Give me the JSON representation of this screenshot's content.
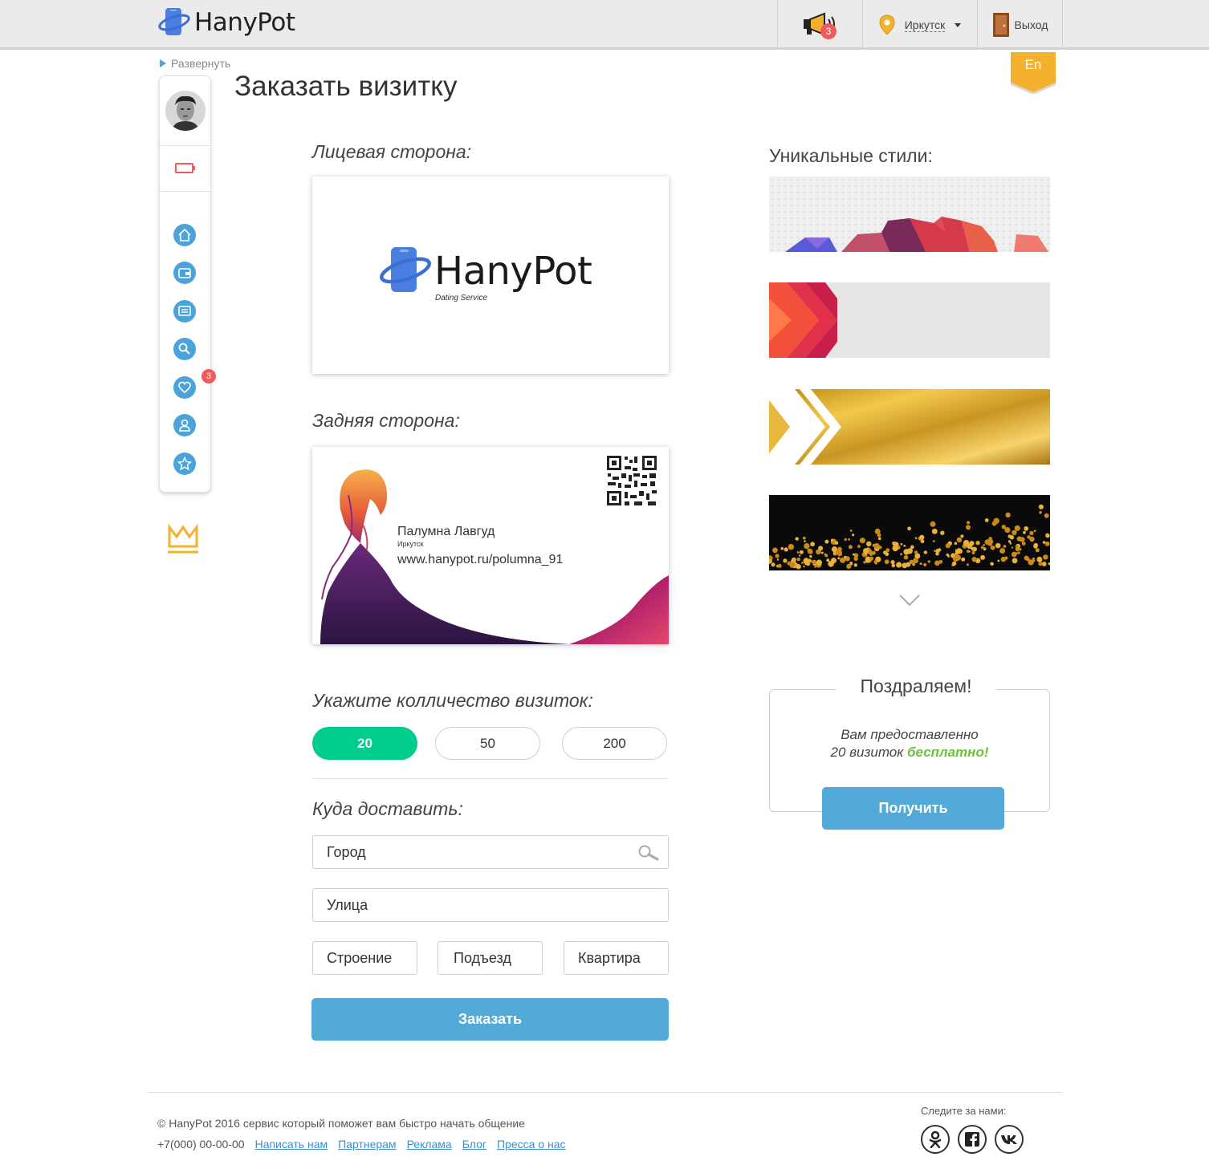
{
  "header": {
    "logo": "HanyPot",
    "notifications_count": "3",
    "city": "Иркутск",
    "exit_label": "Выход",
    "lang": "En"
  },
  "sidebar": {
    "expand_label": "Развернуть",
    "likes_badge": "3",
    "icons": [
      "home-icon",
      "wallet-icon",
      "messages-icon",
      "search-icon",
      "heart-icon",
      "profile-icon",
      "star-icon"
    ]
  },
  "main": {
    "title": "Заказать визитку",
    "front_label": "Лицевая сторона:",
    "back_label": "Задняя сторона:",
    "front_card": {
      "logo": "HanyPot",
      "subtitle": "Dating Service"
    },
    "back_card": {
      "name": "Палумна Лавгуд",
      "city": "Иркутск",
      "url": "www.hanypot.ru/polumna_91"
    },
    "qty_label": "Укажите колличество визиток:",
    "qty_options": [
      "20",
      "50",
      "200"
    ],
    "qty_selected": "20",
    "delivery_label": "Куда доставить:",
    "fields": {
      "city_placeholder": "Город",
      "street_placeholder": "Улица",
      "building_placeholder": "Строение",
      "entrance_placeholder": "Подъезд",
      "apartment_placeholder": "Квартира"
    },
    "order_button": "Заказать"
  },
  "styles": {
    "title": "Уникальные стили:",
    "items": [
      "geometric-mountains",
      "red-chevrons",
      "gold-foil",
      "gold-confetti"
    ]
  },
  "congrats": {
    "title": "Поздраляем!",
    "line1": "Вам предоставленно",
    "line2_prefix": "20 визиток ",
    "line2_free": "бесплатно!",
    "button": "Получить"
  },
  "footer": {
    "copyright": "© HanyPot 2016 сервис который поможет вам быстро начать общение",
    "phone": "+7(000) 00-00-00",
    "links": [
      "Написать нам",
      "Партнерам",
      "Реклама",
      "Блог",
      "Пресса о нас"
    ],
    "follow_label": "Следите за нами:"
  },
  "colors": {
    "accent_blue": "#52aad9",
    "accent_green": "#00cc8e",
    "badge_red": "#ef5a5a",
    "gold": "#f4b12e"
  }
}
